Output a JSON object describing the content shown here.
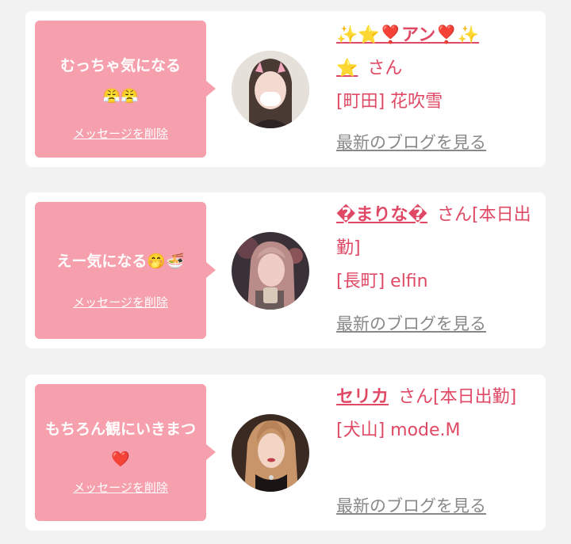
{
  "cards": [
    {
      "message": "むっちゃ気になる",
      "message_emoji": "😤😤",
      "delete_label": "メッセージを削除",
      "name": "✨⭐❣️アン❣️✨",
      "name_suffix": "⭐",
      "san": "さん",
      "shop": "[町田] 花吹雪",
      "blog_link": "最新のブログを見る"
    },
    {
      "message": "えー気になる",
      "message_emoji": "🤭🍜",
      "delete_label": "メッセージを削除",
      "name": "�まりな�",
      "san": "さん[本日出勤]",
      "shop": "[長町] elfin",
      "blog_link": "最新のブログを見る"
    },
    {
      "message": "もちろん観にいきまつ",
      "message_emoji": "❤️",
      "delete_label": "メッセージを削除",
      "name": "セリカ",
      "san": "さん[本日出勤]",
      "shop": "[犬山] mode.M",
      "blog_link": "最新のブログを見る"
    }
  ],
  "colors": {
    "background": "#f2f2f2",
    "card": "#ffffff",
    "bubble": "#f7a0ad",
    "accent": "#e04966",
    "link_gray": "#888888"
  }
}
